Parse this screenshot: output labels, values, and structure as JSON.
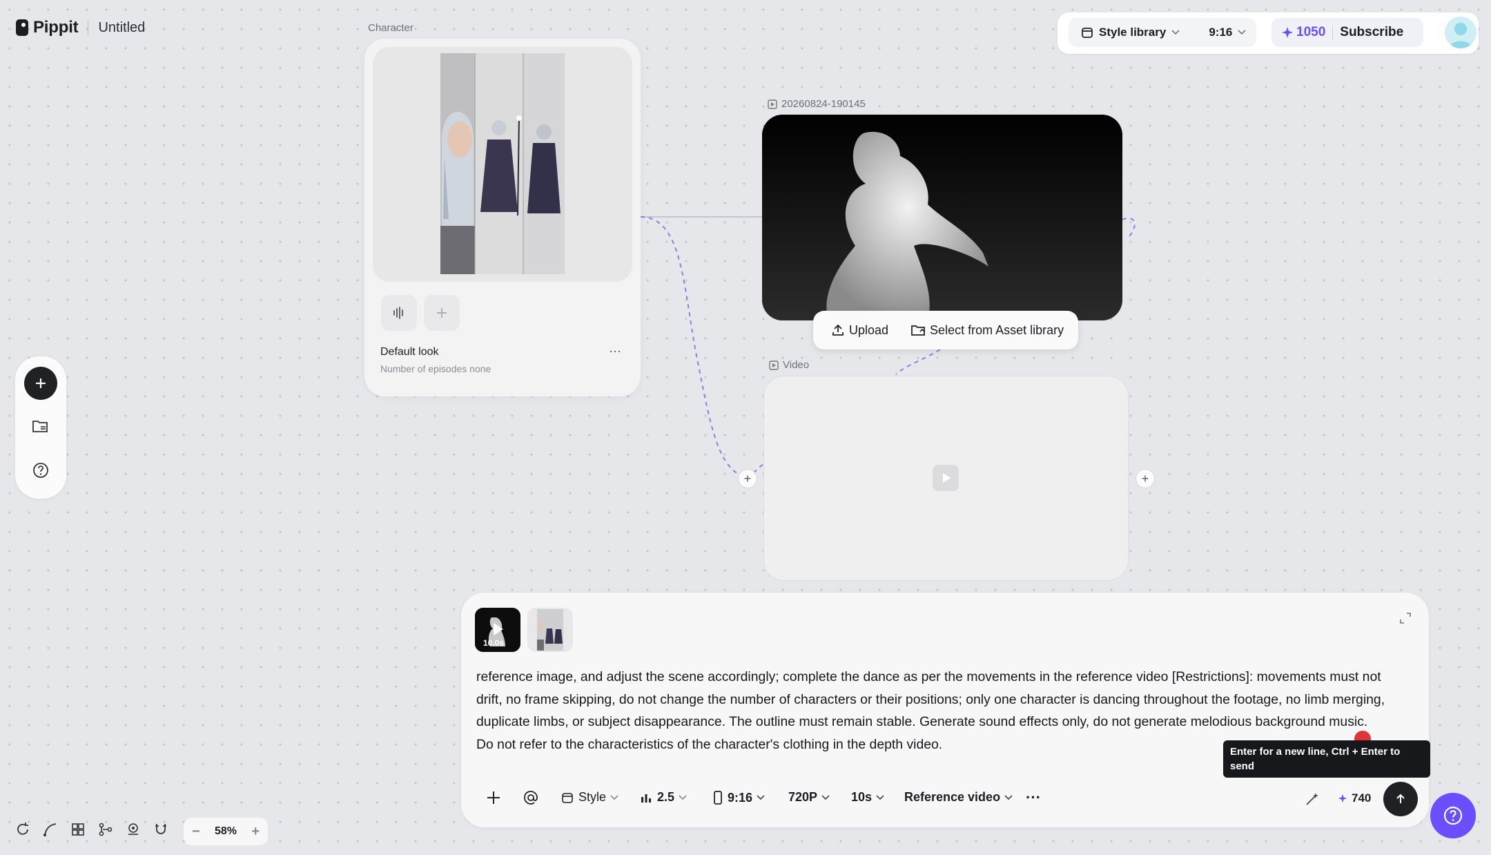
{
  "app": {
    "brand": "Pippit",
    "document_title": "Untitled"
  },
  "topbar": {
    "style_library": "Style library",
    "aspect": "9:16",
    "credits": "1050",
    "subscribe": "Subscribe"
  },
  "character_node": {
    "label": "Character",
    "look_name": "Default look",
    "episodes": "Number of episodes none",
    "more": "···"
  },
  "depth_node": {
    "label": "20260824-190145",
    "upload": "Upload",
    "select_asset": "Select from Asset library"
  },
  "video_node": {
    "label": "Video"
  },
  "prompt": {
    "thumb_duration": "10.0s",
    "text": "reference image, and adjust the scene accordingly; complete the dance as per the movements in the reference video [Restrictions]: movements must not drift, no frame skipping, do not change the number of characters or their positions; only one character is dancing throughout the footage, no limb merging, duplicate limbs, or subject disappearance. The outline must remain stable. Generate sound effects only, do not generate melodious background music. Do not refer to the characteristics of the character's clothing in the depth video.",
    "tooltip": "Enter for a new line, Ctrl + Enter to send",
    "controls": {
      "style": "Style",
      "model": "2.5",
      "aspect": "9:16",
      "resolution": "720P",
      "duration": "10s",
      "mode": "Reference video",
      "more": "···"
    },
    "cost": "740"
  },
  "zoom": {
    "level": "58%"
  },
  "colors": {
    "accent": "#6b4eff",
    "edge_dash": "#8b7cf0"
  }
}
